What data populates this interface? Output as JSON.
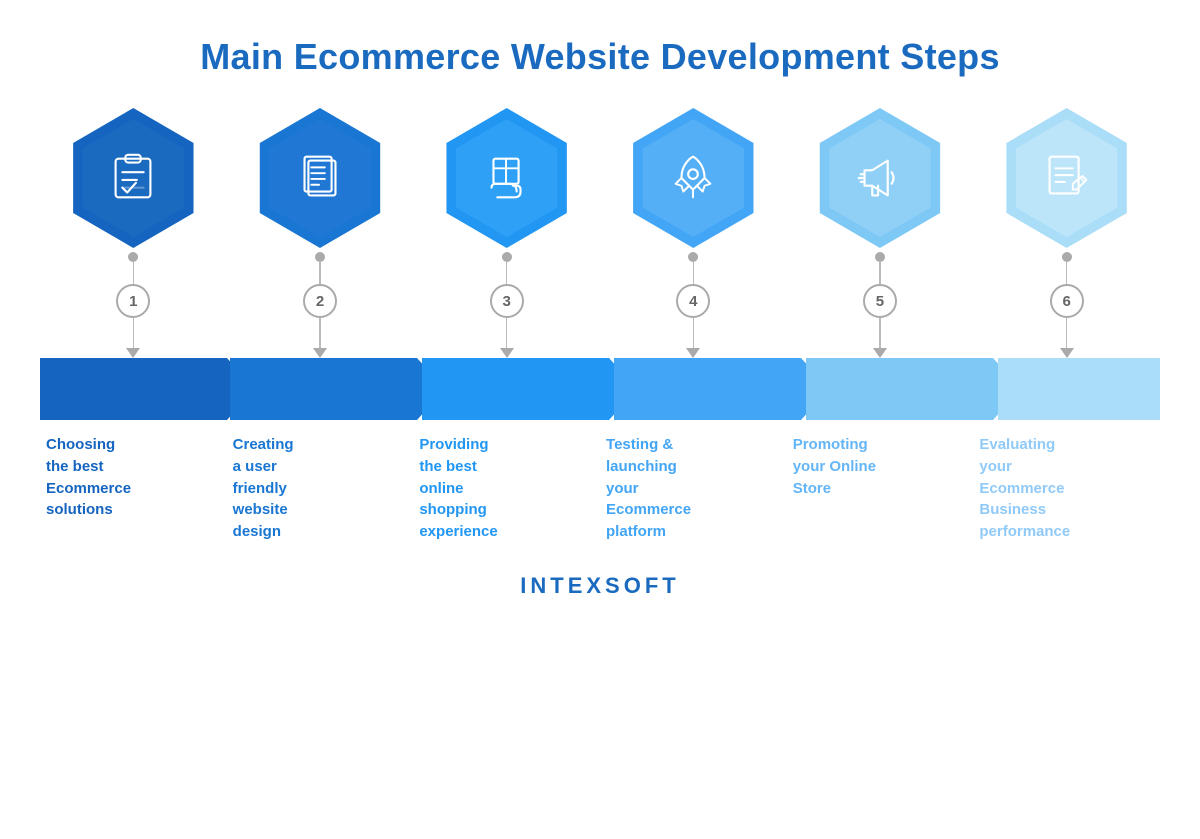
{
  "page": {
    "title": "Main Ecommerce Website Development Steps",
    "brand": "INTEXSOFT"
  },
  "steps": [
    {
      "number": "1",
      "label": "Choosing\nthe best\nEcommerce\nsolutions",
      "icon": "clipboard",
      "color_outer": "#1565c0",
      "color_inner": "#1a6abf",
      "band_color": "#1565c0",
      "label_color": "#1565c0"
    },
    {
      "number": "2",
      "label": "Creating\na user\nfriendly\nwebsite\ndesign",
      "icon": "documents",
      "color_outer": "#1976d2",
      "color_inner": "#2178d4",
      "band_color": "#1976d2",
      "label_color": "#1976d2"
    },
    {
      "number": "3",
      "label": "Providing\nthe best\nonline\nshopping\nexperience",
      "icon": "delivery",
      "color_outer": "#2196f3",
      "color_inner": "#2ea0f6",
      "band_color": "#2196f3",
      "label_color": "#2196f3"
    },
    {
      "number": "4",
      "label": "Testing &\nlaunching\nyour\nEcommerce\nplatform",
      "icon": "rocket",
      "color_outer": "#42a5f5",
      "color_inner": "#54aff7",
      "band_color": "#42a5f5",
      "label_color": "#42a5f5"
    },
    {
      "number": "5",
      "label": "Promoting\nyour Online\nStore",
      "icon": "megaphone",
      "color_outer": "#7ec8f5",
      "color_inner": "#90d0f7",
      "band_color": "#7ec8f5",
      "label_color": "#64b5f6"
    },
    {
      "number": "6",
      "label": "Evaluating\nyour\nEcommerce\nBusiness\nperformance",
      "icon": "report",
      "color_outer": "#aaddf8",
      "color_inner": "#bce5fa",
      "band_color": "#aaddf8",
      "label_color": "#90caf9"
    }
  ]
}
